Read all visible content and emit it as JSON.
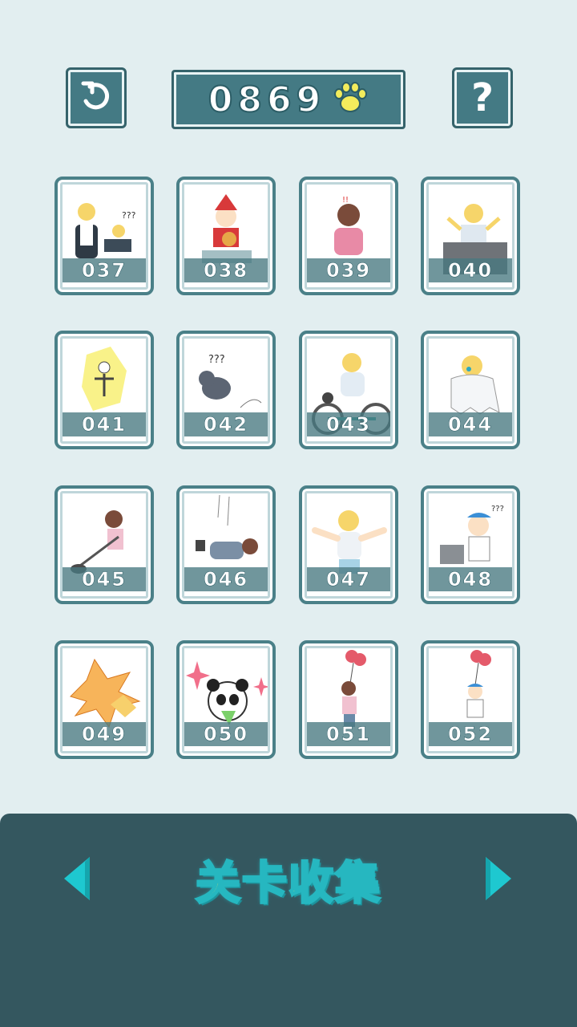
{
  "header": {
    "score": "0869",
    "score_icon": "paw-icon",
    "back_icon": "undo-icon",
    "help_label": "?"
  },
  "levels": [
    {
      "number": "037",
      "scene": "magician-hat"
    },
    {
      "number": "038",
      "scene": "santa-desk"
    },
    {
      "number": "039",
      "scene": "girl-back"
    },
    {
      "number": "040",
      "scene": "box-pop"
    },
    {
      "number": "041",
      "scene": "electric-skeleton"
    },
    {
      "number": "042",
      "scene": "cat-confused"
    },
    {
      "number": "043",
      "scene": "bicycle"
    },
    {
      "number": "044",
      "scene": "ghost-boy"
    },
    {
      "number": "045",
      "scene": "girl-shovel"
    },
    {
      "number": "046",
      "scene": "fall-down"
    },
    {
      "number": "047",
      "scene": "arms-open"
    },
    {
      "number": "048",
      "scene": "cap-boy-printer"
    },
    {
      "number": "049",
      "scene": "explosion"
    },
    {
      "number": "050",
      "scene": "panda-sparkles"
    },
    {
      "number": "051",
      "scene": "girl-balloons"
    },
    {
      "number": "052",
      "scene": "boy-balloons"
    }
  ],
  "footer": {
    "title": "关卡收集",
    "prev_icon": "triangle-left-icon",
    "next_icon": "triangle-right-icon"
  },
  "colors": {
    "background": "#e2eef0",
    "button": "#447a84",
    "panel": "#34575f",
    "title_fill": "#f8e45a",
    "title_outline": "#26b7c0",
    "arrow": "#1ec8d0",
    "paw": "#f3ec5c"
  }
}
